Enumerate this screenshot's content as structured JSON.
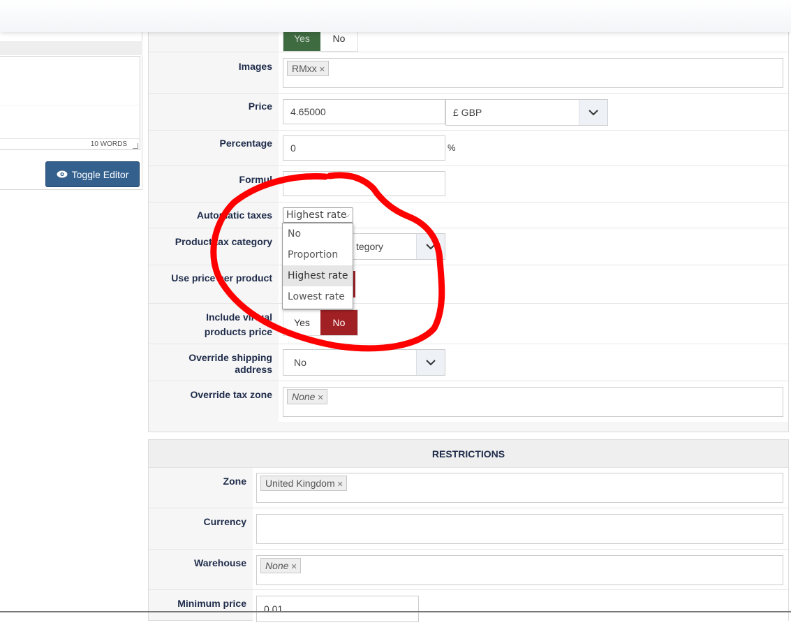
{
  "left_panel": {
    "word_count": "10 WORDS",
    "toggle_editor_label": "Toggle Editor"
  },
  "form": {
    "top_toggle": {
      "yes": "Yes",
      "no": "No"
    },
    "images": {
      "label": "Images",
      "tag": "RMxx"
    },
    "price": {
      "label": "Price",
      "value": "4.65000",
      "currency": "£ GBP"
    },
    "percentage": {
      "label": "Percentage",
      "value": "0",
      "unit": "%"
    },
    "formula": {
      "label": "Formula",
      "visible_label": "Formul"
    },
    "automatic_taxes": {
      "label": "Automatic taxes",
      "selected": "Highest rate",
      "options": [
        "No",
        "Proportion",
        "Highest rate",
        "Lowest rate"
      ]
    },
    "product_tax_category": {
      "label": "Product tax category",
      "partial_value": "tegory"
    },
    "use_price_per_product": {
      "label": "Use price per product"
    },
    "include_virtual": {
      "label_line1": "Include virtual",
      "label_line2": "products price",
      "yes": "Yes",
      "no": "No"
    },
    "override_shipping": {
      "label": "Override shipping address",
      "value": "No"
    },
    "override_tax_zone": {
      "label": "Override tax zone",
      "tag": "None"
    }
  },
  "restrictions": {
    "title": "RESTRICTIONS",
    "zone": {
      "label": "Zone",
      "tag": "United Kingdom"
    },
    "currency": {
      "label": "Currency"
    },
    "warehouse": {
      "label": "Warehouse",
      "tag": "None"
    },
    "minimum_price": {
      "label": "Minimum price",
      "value": "0.01"
    }
  },
  "colors": {
    "toggle_editor_bg": "#34608e",
    "yes_active": "#3f6b41",
    "no_active": "#a12024",
    "annotation_red": "#ff0000"
  }
}
